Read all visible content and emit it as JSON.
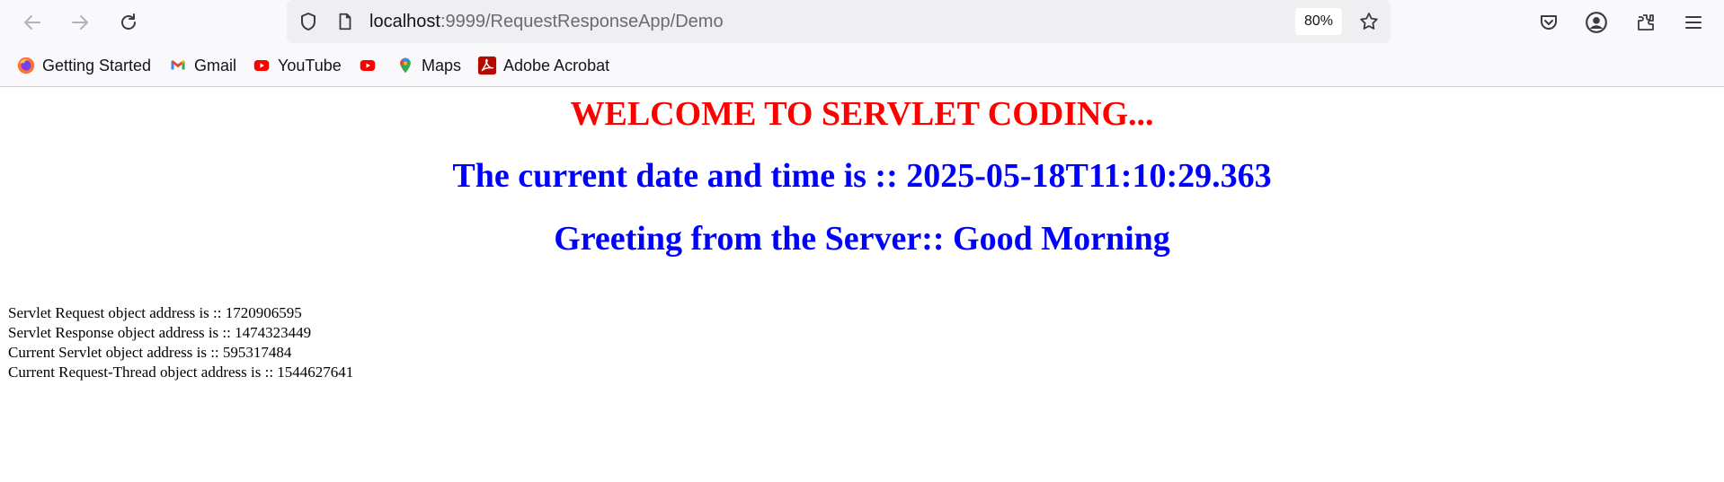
{
  "browser": {
    "url_host": "localhost",
    "url_path": ":9999/RequestResponseApp/Demo",
    "zoom": "80%",
    "icons": {
      "back": "back-arrow-icon",
      "forward": "forward-arrow-icon",
      "reload": "reload-icon",
      "shield": "tracking-shield-icon",
      "page": "page-info-icon",
      "star": "bookmark-star-icon",
      "pocket": "pocket-icon",
      "account": "account-icon",
      "extensions": "extensions-icon",
      "menu": "hamburger-menu-icon"
    }
  },
  "bookmarks": [
    {
      "label": "Getting Started",
      "icon": "firefox-icon"
    },
    {
      "label": "Gmail",
      "icon": "gmail-icon"
    },
    {
      "label": "YouTube",
      "icon": "youtube-icon"
    },
    {
      "label": "",
      "icon": "youtube-icon"
    },
    {
      "label": "Maps",
      "icon": "maps-pin-icon"
    },
    {
      "label": "Adobe Acrobat",
      "icon": "acrobat-icon"
    }
  ],
  "page": {
    "welcome": "WELCOME TO SERVLET CODING...",
    "datetime": "The current date and time is :: 2025-05-18T11:10:29.363",
    "greeting": "Greeting from the Server:: Good Morning",
    "lines": [
      "Servlet Request object address is :: 1720906595",
      "Servlet Response object address is :: 1474323449",
      "Current Servlet object address is :: 595317484",
      "Current Request-Thread object address is :: 1544627641"
    ],
    "colors": {
      "welcome": "#ff0000",
      "heading": "#0000ff"
    }
  }
}
